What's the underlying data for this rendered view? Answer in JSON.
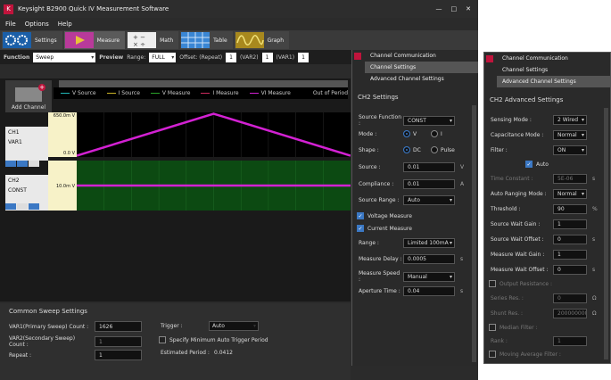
{
  "window": {
    "title": "Keysight B2900 Quick IV Measurement Software",
    "logo": "K",
    "controls": [
      "—",
      "□",
      "✕"
    ]
  },
  "menu": [
    "File",
    "Options",
    "Help"
  ],
  "toolbar": [
    {
      "label": "Settings",
      "icon": "gears-icon"
    },
    {
      "label": "Measure",
      "icon": "play-icon"
    },
    {
      "label": "Math",
      "icon": "calculator-icon"
    },
    {
      "label": "Table",
      "icon": "table-icon"
    },
    {
      "label": "Graph",
      "icon": "waveform-icon"
    }
  ],
  "funcbar": {
    "function_label": "Function",
    "function_value": "Sweep",
    "preview_label": "Preview",
    "range_label": "Range:",
    "range_value": "FULL",
    "offset_label": "Offset: (Repeat)",
    "offset_value": "1",
    "var2_label": "(VAR2)",
    "var2_value": "1",
    "var1_label": "(VAR1)",
    "var1_value": "1"
  },
  "add_channel_label": "Add Channel",
  "legend": [
    {
      "label": "V Source",
      "color": "#21b8b8"
    },
    {
      "label": "I Source",
      "color": "#c9b227"
    },
    {
      "label": "V Measure",
      "color": "#29a329"
    },
    {
      "label": "I Measure",
      "color": "#cc2b5e"
    },
    {
      "label": "VI Measure",
      "color": "#d321d3"
    },
    {
      "label": "Out of Period",
      "color": "#000000"
    }
  ],
  "channels": [
    {
      "name": "CH1",
      "var": "VAR1",
      "top_label": "650.0m V",
      "bottom_label": "0.0  V"
    },
    {
      "name": "CH2",
      "var": "CONST",
      "level_label": "10.0m V"
    }
  ],
  "chart_data": {
    "type": "line",
    "series": [
      {
        "name": "CH1",
        "x": [
          0,
          0.5,
          1
        ],
        "y": [
          0,
          0.65,
          0
        ]
      },
      {
        "name": "CH2",
        "x": [
          0,
          1
        ],
        "y": [
          0.01,
          0.01
        ]
      }
    ],
    "ylim": [
      0,
      0.65
    ]
  },
  "common_sweep": {
    "title": "Common Sweep Settings",
    "var1_label": "VAR1(Primary Sweep) Count :",
    "var1_value": "1626",
    "var2_label": "VAR2(Secondary Sweep) Count :",
    "var2_value": "1",
    "repeat_label": "Repeat :",
    "repeat_value": "1",
    "trigger_label": "Trigger :",
    "trigger_value": "Auto",
    "spec_min_label": "Specify Minimum Auto Trigger Period",
    "est_period_label": "Estimated Period :",
    "est_period_value": "0.0412"
  },
  "ch2_settings": {
    "menu": [
      "Channel Communication",
      "Channel Settings",
      "Advanced Channel Settings"
    ],
    "title": "CH2 Settings",
    "source_function_label": "Source Function :",
    "source_function_value": "CONST",
    "mode_label": "Mode :",
    "mode_v": "V",
    "mode_i": "I",
    "shape_label": "Shape :",
    "shape_dc": "DC",
    "shape_pulse": "Pulse",
    "source_label": "Source :",
    "source_value": "0.01",
    "source_unit": "V",
    "compliance_label": "Compliance :",
    "compliance_value": "0.01",
    "compliance_unit": "A",
    "source_range_label": "Source Range :",
    "source_range_value": "Auto",
    "voltage_measure_label": "Voltage Measure",
    "current_measure_label": "Current Measure",
    "range_label": "Range :",
    "range_value": "Limited 100mA",
    "measure_delay_label": "Measure Delay :",
    "measure_delay_value": "0.0005",
    "measure_delay_unit": "s",
    "measure_speed_label": "Measure Speed :",
    "measure_speed_value": "Manual",
    "aperture_label": "Aperture Time :",
    "aperture_value": "0.04",
    "aperture_unit": "s"
  },
  "ch2_advanced": {
    "menu": [
      "Channel Communication",
      "Channel Settings",
      "Advanced Channel Settings"
    ],
    "title": "CH2 Advanced Settings",
    "sensing_label": "Sensing Mode :",
    "sensing_value": "2 Wired",
    "capacitance_label": "Capacitance Mode :",
    "capacitance_value": "Normal",
    "filter_label": "Filter :",
    "filter_value": "ON",
    "auto_label": "Auto",
    "time_constant_label": "Time Constant :",
    "time_constant_value": "5E-06",
    "time_constant_unit": "s",
    "auto_ranging_label": "Auto Ranging Mode :",
    "auto_ranging_value": "Normal",
    "threshold_label": "Threshold :",
    "threshold_value": "90",
    "threshold_unit": "%",
    "swg_label": "Source Wait Gain :",
    "swg_value": "1",
    "swo_label": "Source Wait Offset :",
    "swo_value": "0",
    "swo_unit": "s",
    "mwg_label": "Measure Wait Gain :",
    "mwg_value": "1",
    "mwo_label": "Measure Wait Offset :",
    "mwo_value": "0",
    "mwo_unit": "s",
    "output_res_label": "Output Resistance :",
    "series_res_label": "Series Res. :",
    "series_res_value": "0",
    "series_res_unit": "Ω",
    "shunt_res_label": "Shunt Res. :",
    "shunt_res_value": "2000000000",
    "shunt_res_unit": "Ω",
    "median_label": "Median Filter :",
    "rank_label": "Rank :",
    "rank_value": "1",
    "moving_avg_label": "Moving Average Filter :"
  }
}
